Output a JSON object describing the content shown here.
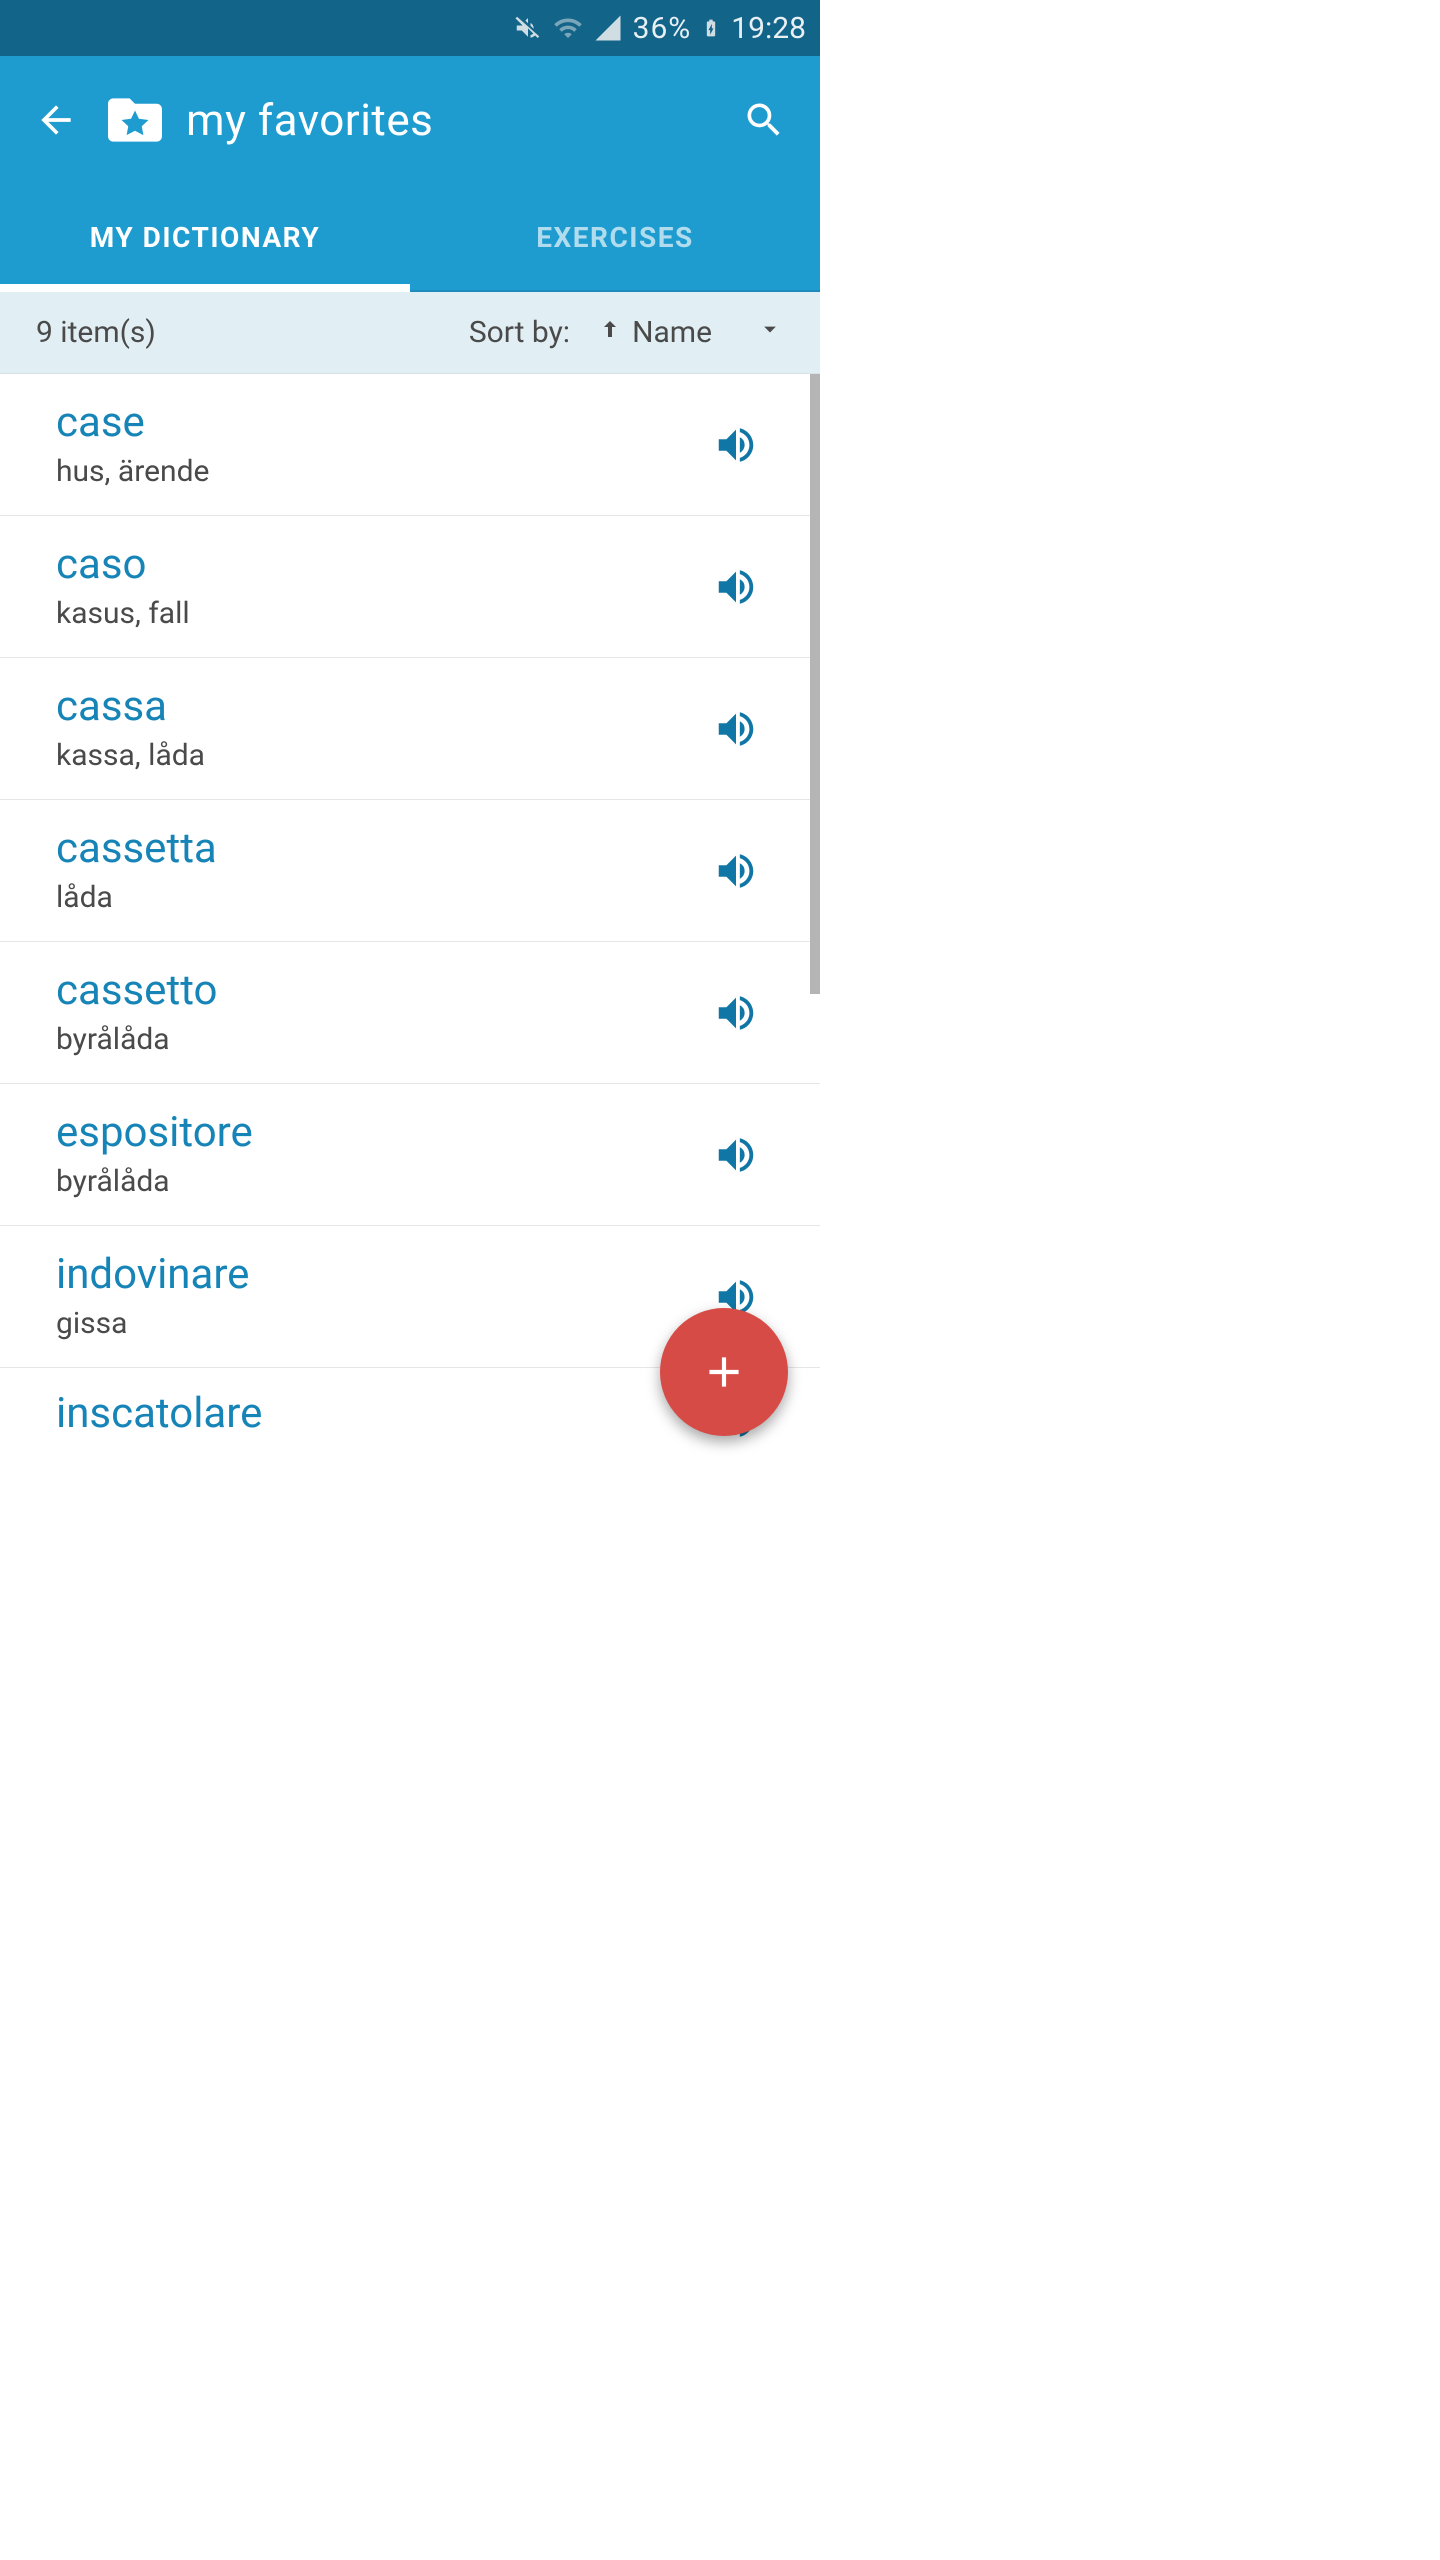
{
  "status": {
    "battery_pct": "36%",
    "time": "19:28"
  },
  "appbar": {
    "title": "my favorites"
  },
  "tabs": {
    "dictionary": "MY DICTIONARY",
    "exercises": "EXERCISES"
  },
  "sort": {
    "count": "9 item(s)",
    "label": "Sort by:",
    "field": "Name"
  },
  "entries": [
    {
      "word": "case",
      "translation": "hus, ärende"
    },
    {
      "word": "caso",
      "translation": "kasus, fall"
    },
    {
      "word": "cassa",
      "translation": "kassa, låda"
    },
    {
      "word": "cassetta",
      "translation": "låda"
    },
    {
      "word": "cassetto",
      "translation": "byrålåda"
    },
    {
      "word": "espositore",
      "translation": "byrålåda"
    },
    {
      "word": "indovinare",
      "translation": "gissa"
    },
    {
      "word": "inscatolare",
      "translation": ""
    }
  ],
  "colors": {
    "status_bg": "#136489",
    "appbar_bg": "#1e9ccf",
    "accent": "#1784b7",
    "fab": "#d64b46"
  }
}
